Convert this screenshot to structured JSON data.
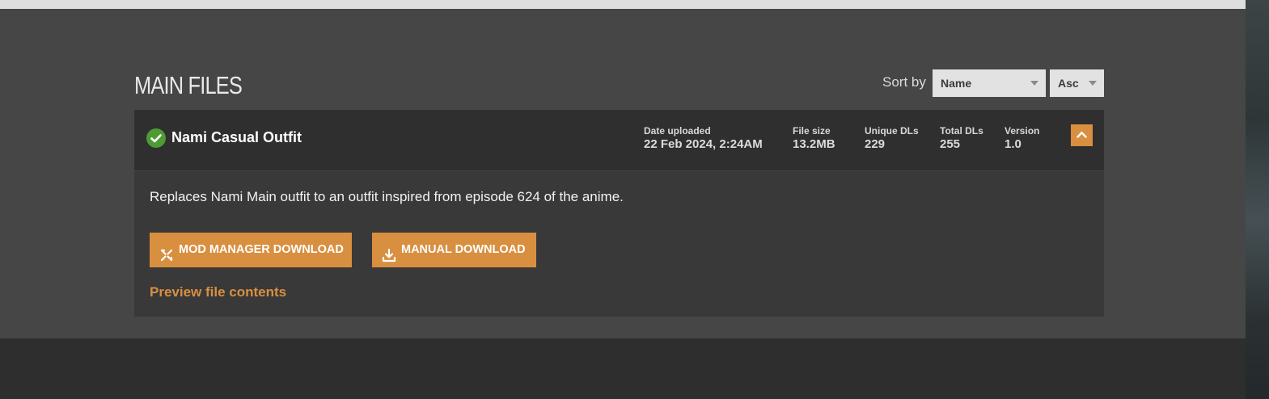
{
  "section": {
    "title": "MAIN FILES"
  },
  "sort": {
    "label": "Sort by",
    "field": "Name",
    "direction": "Asc"
  },
  "file": {
    "name": "Nami Casual Outfit",
    "stats": [
      {
        "label": "Date uploaded",
        "value": "22 Feb 2024, 2:24AM"
      },
      {
        "label": "File size",
        "value": "13.2MB"
      },
      {
        "label": "Unique DLs",
        "value": "229"
      },
      {
        "label": "Total DLs",
        "value": "255"
      },
      {
        "label": "Version",
        "value": "1.0"
      }
    ],
    "description": "Replaces Nami Main outfit to an outfit inspired from episode 624 of the anime.",
    "buttons": {
      "mod_manager": "MOD MANAGER DOWNLOAD",
      "manual": "MANUAL DOWNLOAD"
    },
    "preview_link": "Preview file contents"
  },
  "colors": {
    "accent": "#d98f40",
    "success": "#4e9a33",
    "panel": "#2f2f2f",
    "body": "#393939",
    "background": "#464646"
  },
  "icons": {
    "status": "check-circle-icon",
    "toggle": "chevron-up-icon",
    "mod_manager": "vortex-icon",
    "manual": "download-icon"
  }
}
